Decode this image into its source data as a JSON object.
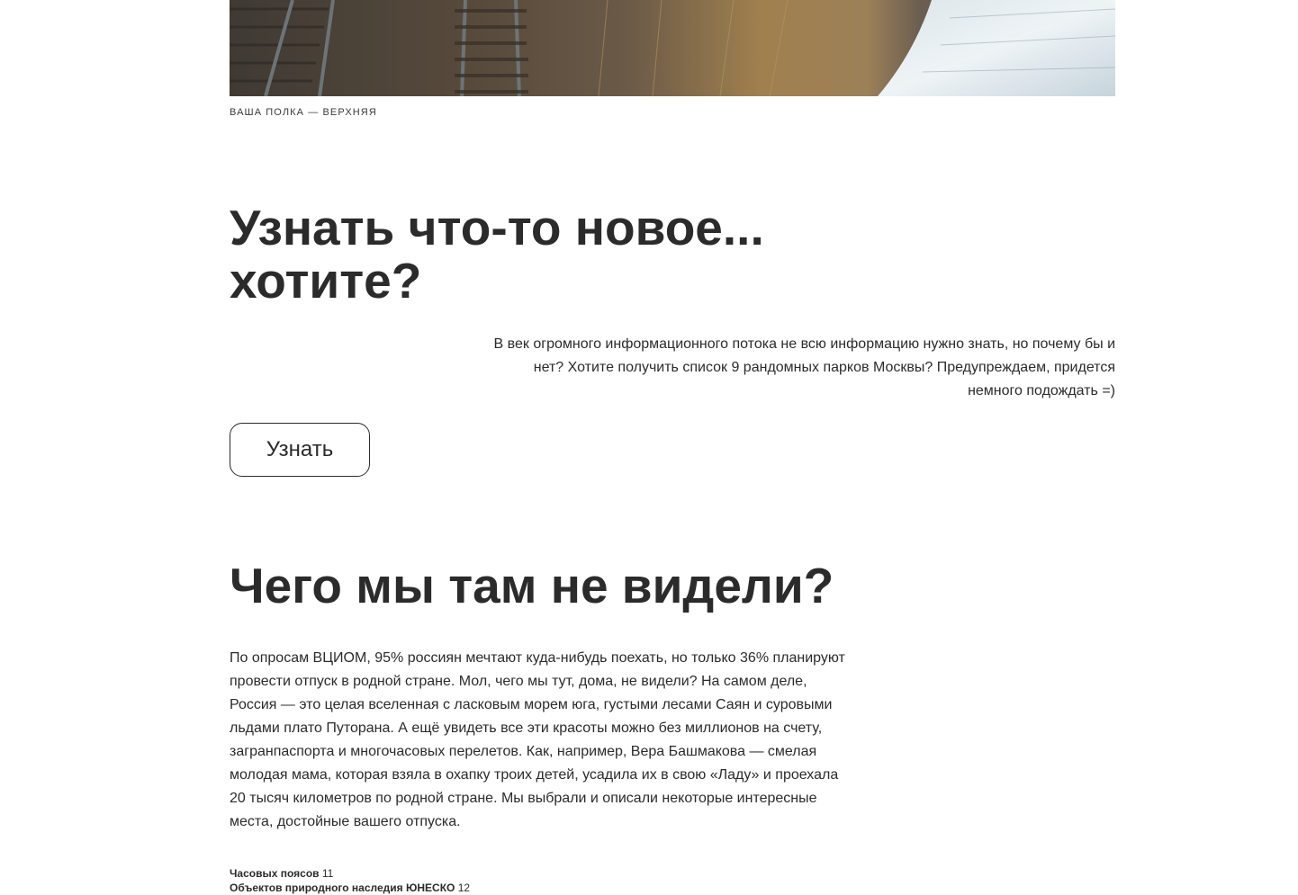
{
  "hero": {
    "caption": "Ваша полка — верхняя"
  },
  "intro": {
    "title": "Узнать что-то новое... хотите?",
    "lead": "В век огромного информационного потока не всю информацию нужно знать, но почему бы и нет? Хотите получить список 9 рандомных парков Москвы? Предупреждаем, придется немного подождать =)",
    "button_label": "Узнать"
  },
  "article": {
    "title": "Чего мы там не видели?",
    "body": "По опросам ВЦИОМ, 95% россиян мечтают куда-нибудь поехать, но только 36% планируют провести отпуск в родной стране. Мол, чего мы тут, дома, не видели? На самом деле, Россия — это целая вселенная с ласковым морем юга, густыми лесами Саян и суровыми льдами плато Путорана. А ещё увидеть все эти красоты можно без миллионов на счету, загранпаспорта и многочасовых перелетов. Как, например, Вера Башмакова — смелая молодая мама, которая взяла в охапку троих детей, усадила их в свою «Ладу» и проехала 20 тысяч километров по родной стране. Мы выбрали и описали некоторые интересные места, достойные вашего отпуска.",
    "facts": [
      {
        "label": "Часовых поясов",
        "value": "11"
      },
      {
        "label": "Объектов природного наследия ЮНЕСКО",
        "value": "12"
      }
    ]
  }
}
